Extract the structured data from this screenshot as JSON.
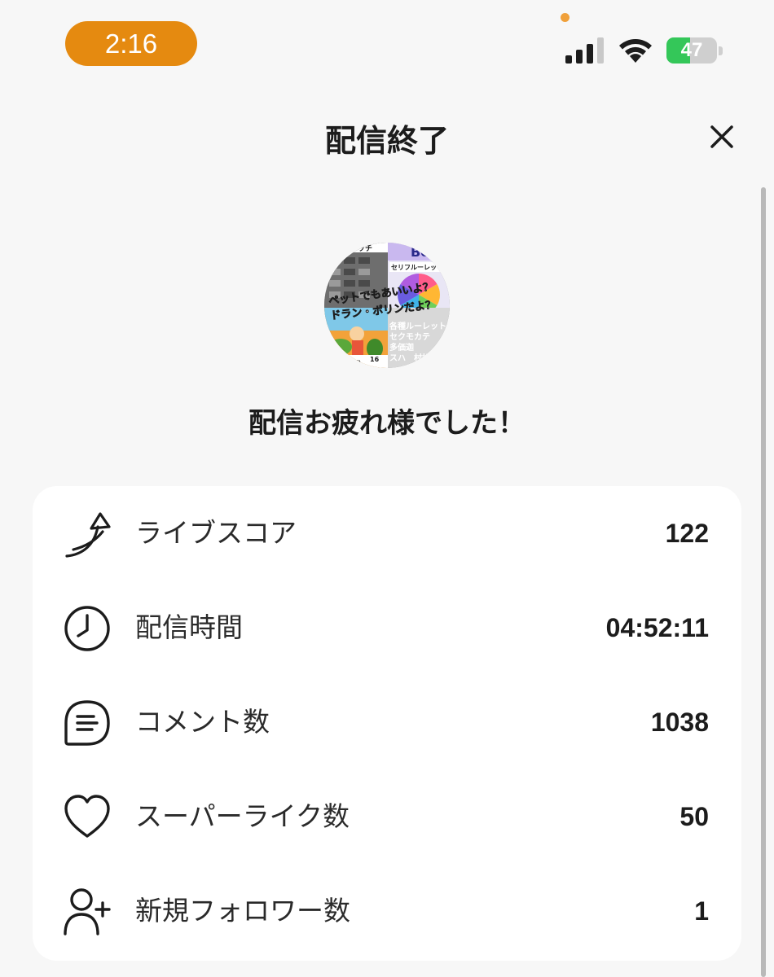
{
  "status_bar": {
    "time": "2:16",
    "battery_percent": "47",
    "battery_level": 0.47,
    "accent_color": "#e58a10",
    "battery_color": "#34c759"
  },
  "header": {
    "title": "配信終了",
    "close_icon": "close-icon"
  },
  "avatar": {
    "texts": {
      "t1": "ラッチ",
      "t2": "Be",
      "t3": "セリフルーレッ",
      "t4": "ペットでもあいいよ？",
      "t5": "ドラン・ポリンだよ？",
      "t6": "各種ルーレット",
      "t7": "セクモカテ",
      "t8": "多価迦",
      "t9": "スハ",
      "t10": "村松",
      "t11": "ム者）",
      "t12": "16"
    }
  },
  "message": "配信お疲れ様でした！",
  "stats": [
    {
      "icon": "rising-arrow-icon",
      "label": "ライブスコア",
      "value": "122"
    },
    {
      "icon": "clock-icon",
      "label": "配信時間",
      "value": "04:52:11"
    },
    {
      "icon": "comment-icon",
      "label": "コメント数",
      "value": "1038"
    },
    {
      "icon": "heart-icon",
      "label": "スーパーライク数",
      "value": "50"
    },
    {
      "icon": "add-user-icon",
      "label": "新規フォロワー数",
      "value": "1"
    }
  ]
}
